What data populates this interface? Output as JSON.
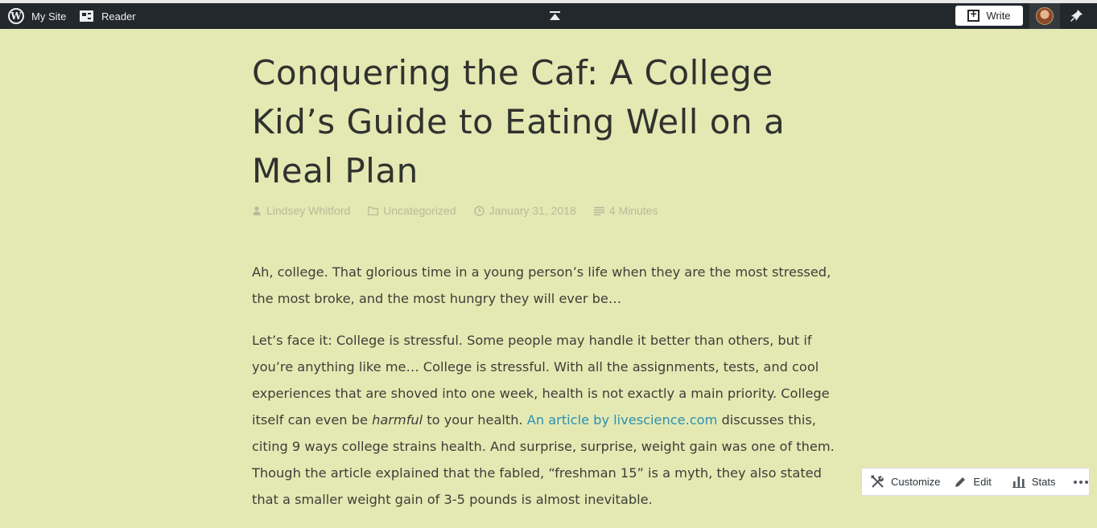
{
  "adminbar": {
    "my_site_label": "My Site",
    "reader_label": "Reader",
    "write_label": "Write",
    "icons": {
      "wp": "wordpress-logo-icon",
      "reader": "reader-icon",
      "collapse": "collapse-up-icon",
      "write": "write-icon",
      "notifications": "bell-icon"
    }
  },
  "post": {
    "title": "Conquering the Caf: A College Kid’s Guide to Eating Well on a Meal Plan",
    "author": "Lindsey Whitford",
    "category": "Uncategorized",
    "date": "January 31, 2018",
    "read_time": "4 Minutes",
    "paragraph1": "Ah, college. That glorious time in a young person’s life when they are the most stressed, the most broke, and the most hungry they will ever be…",
    "p2_text_a": "Let’s face it: College is stressful. Some people may handle it better than others, but if you’re anything like me… College is stressful. With all the assignments, tests, and cool experiences that are shoved into one week, health is not exactly a main priority. College itself can even be ",
    "p2_em": "harmful",
    "p2_text_b": " to your health. ",
    "p2_link": "An article by livescience.com",
    "p2_text_c": " discusses this, citing 9 ways college strains health. And surprise, surprise, weight gain was one of them. Though the article explained that the fabled, “freshman 15” is a myth, they also stated that a smaller weight gain of 3-5 pounds is almost inevitable."
  },
  "action_bar": {
    "customize_label": "Customize",
    "edit_label": "Edit",
    "stats_label": "Stats"
  },
  "colors": {
    "background": "#e4e9b3",
    "adminbar": "#23282d",
    "link": "#2c8fb1",
    "meta": "#b8bb9a"
  }
}
